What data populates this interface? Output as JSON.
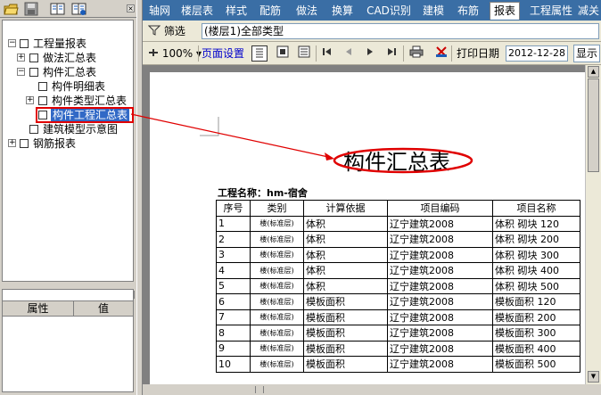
{
  "tree": {
    "items": [
      {
        "label": "工程量报表",
        "toggle": "−"
      },
      {
        "label": "做法汇总表",
        "toggle": "+"
      },
      {
        "label": "构件汇总表",
        "toggle": "−"
      },
      {
        "label": "构件明细表",
        "toggle": ""
      },
      {
        "label": "构件类型汇总表",
        "toggle": "+"
      },
      {
        "label": "构件工程汇总表",
        "toggle": ""
      },
      {
        "label": "建筑模型示意图",
        "toggle": ""
      },
      {
        "label": "钢筋报表",
        "toggle": "+"
      }
    ]
  },
  "properties": {
    "col_attr": "属性",
    "col_value": "值"
  },
  "menu": {
    "items": [
      "轴网",
      "楼层表",
      "样式",
      "配筋",
      "做法",
      "换算",
      "CAD识别",
      "建模",
      "布筋",
      "报表",
      "工程属性",
      "减关"
    ],
    "active": "报表"
  },
  "filter": {
    "button_label": "筛选",
    "value": "(楼层1)全部类型"
  },
  "printbar": {
    "zoom": "100%",
    "page_setup": "页面设置",
    "print_date_label": "打印日期",
    "print_date": "2012-12-28",
    "show_label": "显示"
  },
  "report": {
    "title": "构件汇总表",
    "project_line": "工程名称：hm-宿舍",
    "headers": [
      "序号",
      "类别",
      "计算依据",
      "项目编码",
      "项目名称"
    ],
    "rows": [
      [
        "1",
        "楼(标准层)",
        "体积",
        "辽宁建筑2008",
        "体积 砌块 120"
      ],
      [
        "2",
        "楼(标准层)",
        "体积",
        "辽宁建筑2008",
        "体积 砌块 200"
      ],
      [
        "3",
        "楼(标准层)",
        "体积",
        "辽宁建筑2008",
        "体积 砌块 300"
      ],
      [
        "4",
        "楼(标准层)",
        "体积",
        "辽宁建筑2008",
        "体积 砌块 400"
      ],
      [
        "5",
        "楼(标准层)",
        "体积",
        "辽宁建筑2008",
        "体积 砌块 500"
      ],
      [
        "6",
        "楼(标准层)",
        "模板面积",
        "辽宁建筑2008",
        "模板面积 120"
      ],
      [
        "7",
        "楼(标准层)",
        "模板面积",
        "辽宁建筑2008",
        "模板面积 200"
      ],
      [
        "8",
        "楼(标准层)",
        "模板面积",
        "辽宁建筑2008",
        "模板面积 300"
      ],
      [
        "9",
        "楼(标准层)",
        "模板面积",
        "辽宁建筑2008",
        "模板面积 400"
      ],
      [
        "10",
        "楼(标准层)",
        "模板面积",
        "辽宁建筑2008",
        "模板面积 500"
      ]
    ]
  },
  "colors": {
    "menu_bg": "#3a6ea5",
    "selection": "#3169c6",
    "annotation": "#e00000"
  }
}
